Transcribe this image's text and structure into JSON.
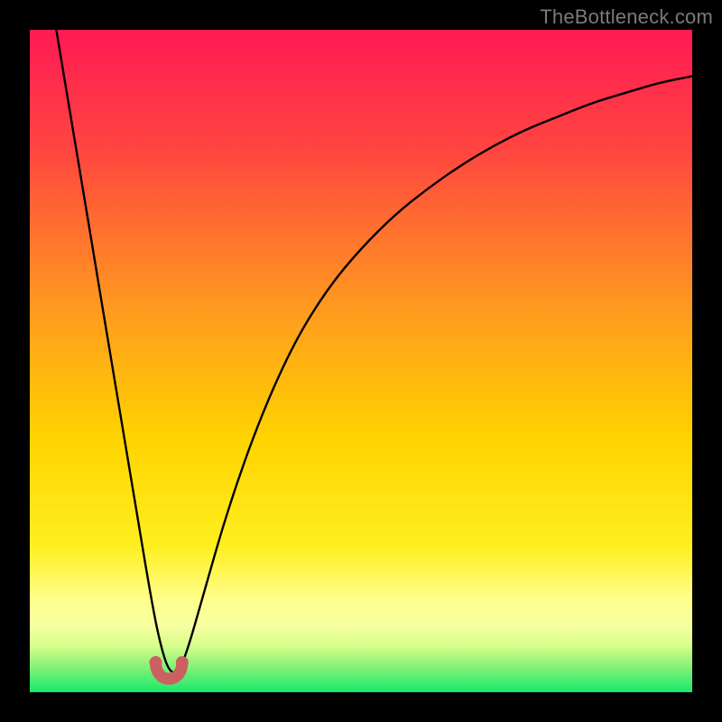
{
  "watermark": "TheBottleneck.com",
  "colors": {
    "frame": "#000000",
    "top": "#ff1a54",
    "mid": "#ffd400",
    "low": "#ffff7a",
    "bottom": "#17e86b",
    "curve": "#000000",
    "bump": "#cc6060"
  },
  "chart_data": {
    "type": "line",
    "title": "",
    "xlabel": "",
    "ylabel": "",
    "xlim": [
      0,
      100
    ],
    "ylim": [
      0,
      100
    ],
    "series": [
      {
        "name": "bottleneck-curve",
        "x": [
          4,
          6,
          8,
          10,
          12,
          14,
          16,
          18,
          19.5,
          21,
          22.5,
          24,
          26,
          30,
          35,
          40,
          45,
          50,
          55,
          60,
          65,
          70,
          75,
          80,
          85,
          90,
          95,
          100
        ],
        "y": [
          100,
          88,
          76,
          64,
          52,
          40,
          28,
          16,
          8,
          3,
          3,
          7,
          14,
          28,
          42,
          53,
          61,
          67,
          72,
          76,
          79.5,
          82.5,
          85,
          87,
          89,
          90.5,
          92,
          93
        ]
      }
    ],
    "optimal_region_x": [
      19,
      23
    ],
    "gradient_stops": [
      {
        "pos": 0.0,
        "color": "#ff1a54"
      },
      {
        "pos": 0.5,
        "color": "#ffae00"
      },
      {
        "pos": 0.78,
        "color": "#ffe900"
      },
      {
        "pos": 0.87,
        "color": "#ffff8c"
      },
      {
        "pos": 0.92,
        "color": "#f1ff6f"
      },
      {
        "pos": 0.965,
        "color": "#7cf06a"
      },
      {
        "pos": 1.0,
        "color": "#17e86b"
      }
    ]
  }
}
